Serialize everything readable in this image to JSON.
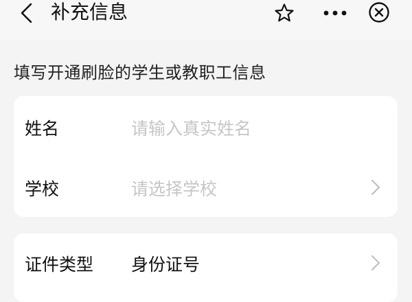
{
  "header": {
    "title": "补充信息",
    "icons": {
      "back": "chevron-left-icon",
      "favorite": "star-icon",
      "more": "more-dots-icon",
      "close": "close-circle-icon"
    }
  },
  "subtitle": "填写开通刷脸的学生或教职工信息",
  "form": {
    "name": {
      "label": "姓名",
      "placeholder": "请输入真实姓名"
    },
    "school": {
      "label": "学校",
      "placeholder": "请选择学校"
    },
    "id_type": {
      "label": "证件类型",
      "value": "身份证号"
    }
  },
  "colors": {
    "background": "#f4f4f4",
    "card": "#ffffff",
    "placeholder": "#c6c6c6",
    "text": "#111111",
    "chevron": "#bdbdbd"
  }
}
